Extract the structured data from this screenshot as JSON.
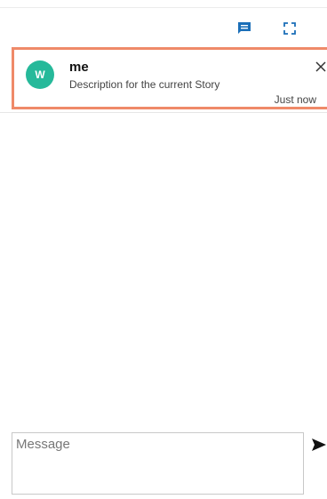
{
  "toolbar": {
    "comment_icon": "comment-icon",
    "expand_icon": "expand-icon"
  },
  "story": {
    "avatar_initial": "W",
    "name": "me",
    "description": "Description for the current Story",
    "time": "Just now",
    "avatar_color": "#26b99a",
    "highlight_color": "#ef8a69"
  },
  "composer": {
    "placeholder": "Message",
    "value": ""
  },
  "colors": {
    "accent": "#1b6fb8"
  }
}
